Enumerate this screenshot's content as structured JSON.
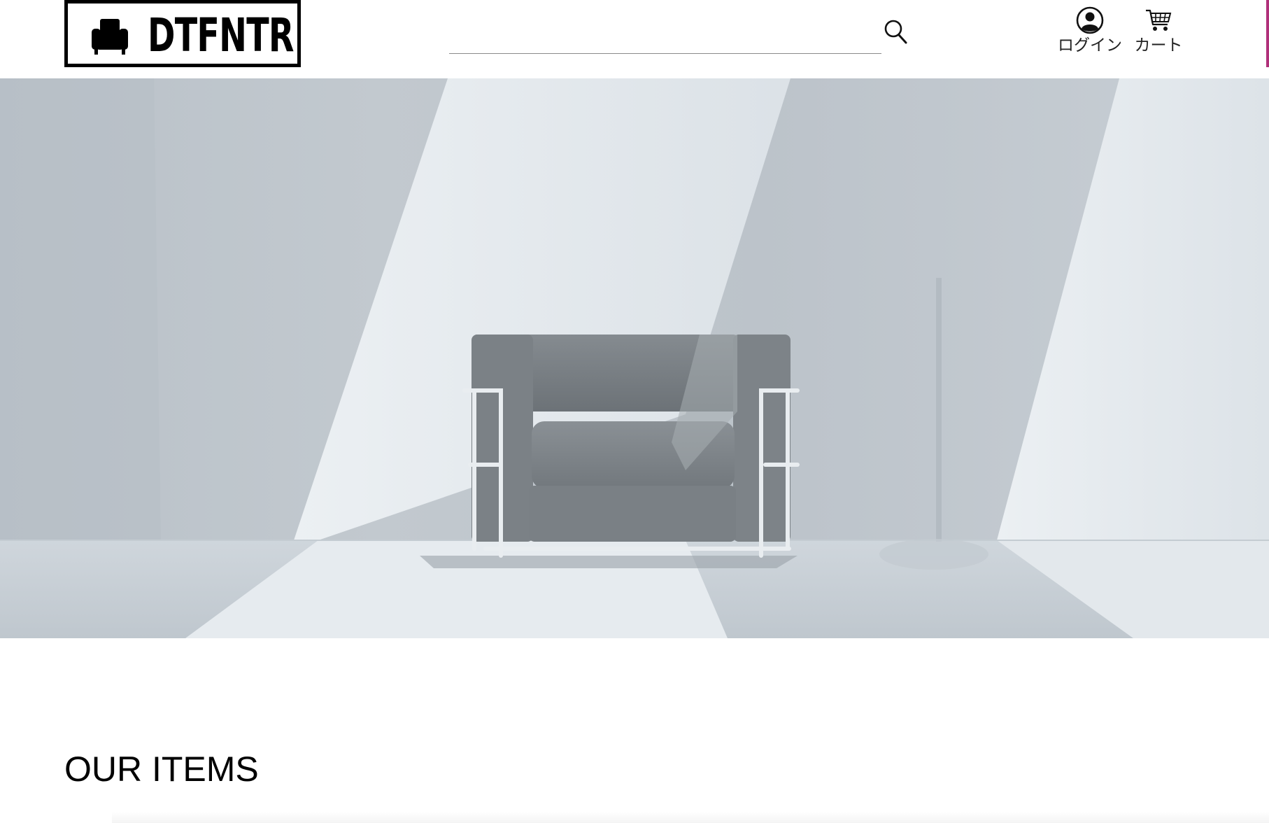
{
  "header": {
    "logo_text": "DTFNTR",
    "logo_icon": "armchair-icon",
    "search": {
      "value": "",
      "placeholder": "",
      "button_icon": "search-icon"
    },
    "nav": {
      "login_label": "ログイン",
      "login_icon": "user-circle-icon",
      "cart_label": "カート",
      "cart_icon": "shopping-cart-icon"
    }
  },
  "hero": {
    "image": "armchair-in-sunlit-room",
    "palette": [
      "#c9d0d6",
      "#dfe4e8",
      "#7d8389"
    ]
  },
  "items_section": {
    "title": "OUR ITEMS"
  },
  "colors": {
    "accent": "#b0307a",
    "text": "#000000",
    "background": "#ffffff"
  }
}
